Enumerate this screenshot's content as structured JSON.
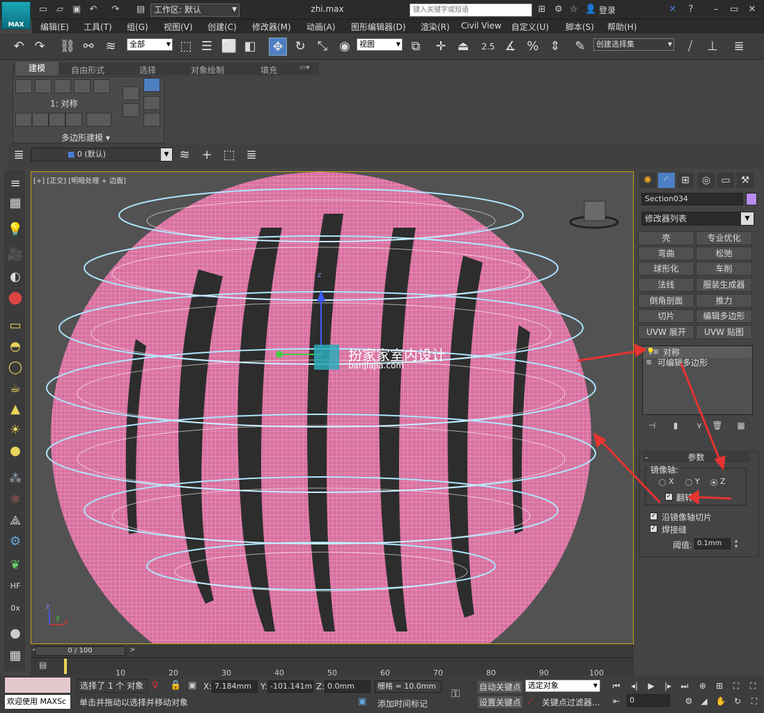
{
  "titlebar": {
    "logo_label": "MAX",
    "workspace_label": "工作区: 默认",
    "document_title": "zhi.max",
    "search_placeholder": "键入关键字或短语",
    "login_label": "登录"
  },
  "menubar": {
    "items": [
      "编辑(E)",
      "工具(T)",
      "组(G)",
      "视图(V)",
      "创建(C)",
      "修改器(M)",
      "动画(A)",
      "图形编辑器(D)",
      "渲染(R)",
      "Civil View",
      "自定义(U)",
      "脚本(S)",
      "帮助(H)"
    ]
  },
  "toolbar": {
    "filter_select": "全部",
    "refcoord_select": "视图",
    "snap_value": "2.5",
    "named_selection": "创建选择集"
  },
  "ribbon": {
    "tabs": [
      "建模",
      "自由形式",
      "选择",
      "对象绘制",
      "填充"
    ],
    "selection_level": "1: 对称",
    "panel_label": "多边形建模"
  },
  "layerbar": {
    "layer_label": "0 (默认)"
  },
  "viewport": {
    "label": "[+] [正交] [明暗处理 + 边面]",
    "watermark_title": "扮家家室内设计",
    "watermark_url": "banjiajia.com",
    "axis_z": "z",
    "axis_y": "y",
    "axis_x": "x"
  },
  "command_panel": {
    "object_name": "Section034",
    "object_color": "#b88cf0",
    "modifier_list": "修改器列表",
    "modifier_buttons": [
      "壳",
      "专业优化",
      "弯曲",
      "松弛",
      "球形化",
      "车削",
      "法线",
      "服装生成器",
      "倒角剖面",
      "推力",
      "切片",
      "编辑多边形",
      "UVW 展开",
      "UVW 贴图"
    ],
    "stack": [
      "对称",
      "可编辑多边形"
    ],
    "params_title": "参数",
    "mirror_axis_label": "镜像轴:",
    "axis_x": "X",
    "axis_y": "Y",
    "axis_z": "Z",
    "flip_label": "翻转",
    "slice_label": "沿镜像轴切片",
    "weld_label": "焊接缝",
    "threshold_label": "阈值:",
    "threshold_value": "0.1mm"
  },
  "timeline": {
    "slider_label": "0 / 100",
    "ticks": [
      "10",
      "20",
      "30",
      "40",
      "50",
      "60",
      "70",
      "80",
      "90",
      "100"
    ]
  },
  "status": {
    "selected": "选择了 1 个 对象",
    "hint": "单击并拖动以选择并移动对象",
    "x_label": "X:",
    "x_value": "7.184mm",
    "y_label": "Y:",
    "y_value": "-101.141m",
    "z_label": "Z:",
    "z_value": "0.0mm",
    "grid": "栅格 = 10.0mm",
    "add_time_tag": "添加时间标记",
    "auto_key": "自动关键点",
    "set_key": "设置关键点",
    "selected_object": "选定对象",
    "key_filters": "关键点过滤器...",
    "frame": "0",
    "welcome": "欢迎使用 MAXSc"
  }
}
